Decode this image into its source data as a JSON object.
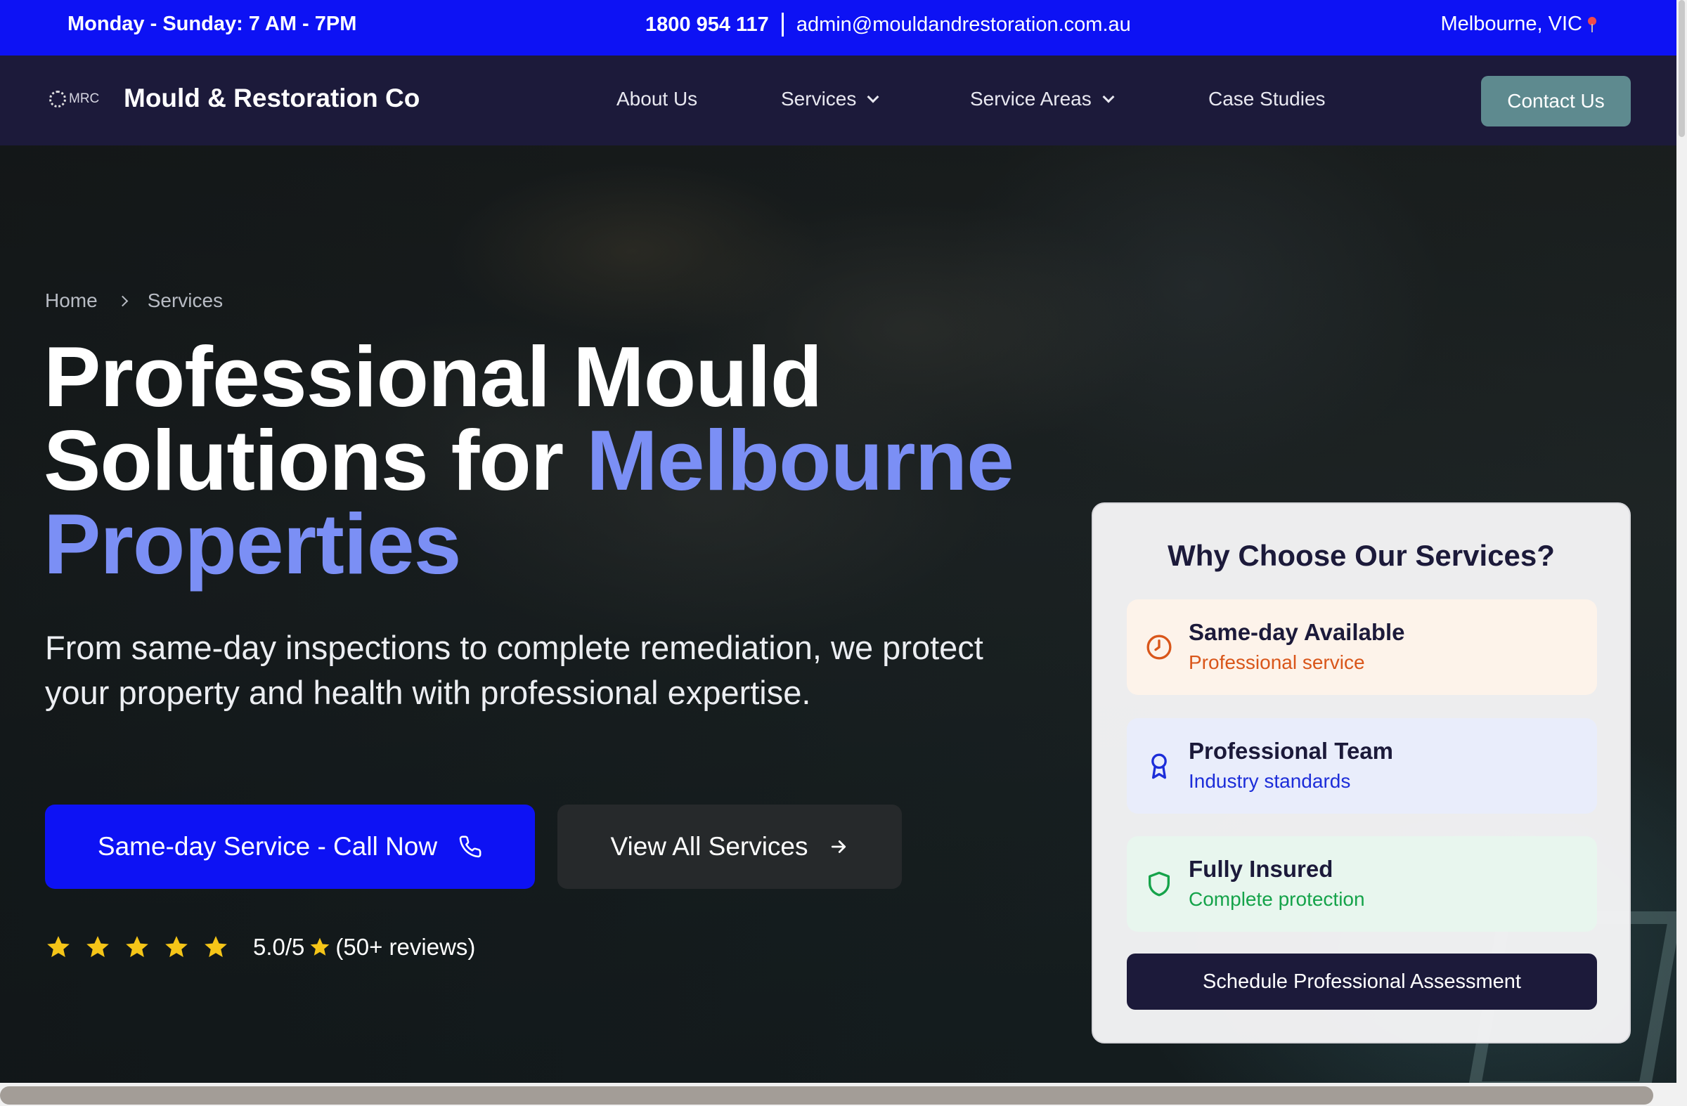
{
  "topbar": {
    "hours": "Monday - Sunday: 7 AM - 7PM",
    "phone": "1800 954 117",
    "email": "admin@mouldandrestoration.com.au",
    "location": "Melbourne, VIC"
  },
  "nav": {
    "logo_text": "MRC",
    "brand": "Mould & Restoration Co",
    "links": [
      "About Us",
      "Services",
      "Service Areas",
      "Case Studies"
    ],
    "contact_button": "Contact Us"
  },
  "hero": {
    "breadcrumb": [
      "Home",
      "Services"
    ],
    "title_line1": "Professional Mould",
    "title_line2_plain": "Solutions for ",
    "title_line2_accent": "Melbourne",
    "title_line3_accent": "Properties",
    "subtitle": "From same-day inspections to complete remediation, we protect your property and health with professional expertise.",
    "primary_button": "Same-day Service - Call Now",
    "secondary_button": "View All Services",
    "rating": {
      "score_text": "5.0/5",
      "reviews_text": "(50+ reviews)",
      "stars": 5
    }
  },
  "card": {
    "title": "Why Choose Our Services?",
    "features": [
      {
        "name": "Same-day Available",
        "desc": "Professional service",
        "icon": "clock-icon"
      },
      {
        "name": "Professional Team",
        "desc": "Industry standards",
        "icon": "award-icon"
      },
      {
        "name": "Fully Insured",
        "desc": "Complete protection",
        "icon": "shield-icon"
      }
    ],
    "cta": "Schedule Professional Assessment"
  },
  "colors": {
    "brand_blue": "#0d12f4",
    "navy": "#1c1a3a",
    "accent_text": "#7b8ff5",
    "contact_button": "#5e8a8f",
    "star": "#f5c518"
  }
}
